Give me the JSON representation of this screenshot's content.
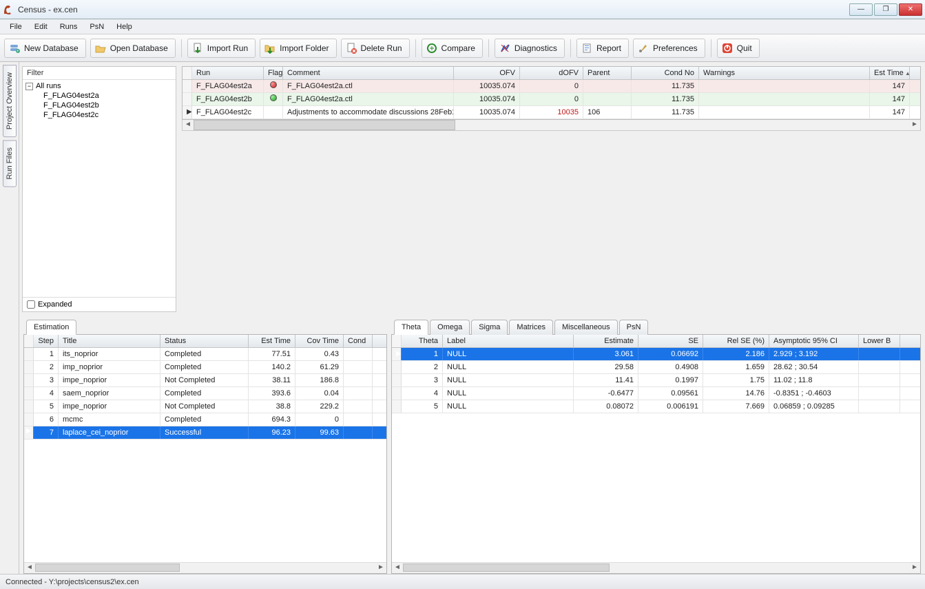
{
  "window": {
    "title": "Census - ex.cen"
  },
  "menu": [
    "File",
    "Edit",
    "Runs",
    "PsN",
    "Help"
  ],
  "toolbar": [
    {
      "k": "new-database",
      "label": "New Database"
    },
    {
      "k": "open-database",
      "label": "Open Database"
    },
    {
      "k": "import-run",
      "label": "Import Run"
    },
    {
      "k": "import-folder",
      "label": "Import Folder"
    },
    {
      "k": "delete-run",
      "label": "Delete Run"
    },
    {
      "k": "compare",
      "label": "Compare"
    },
    {
      "k": "diagnostics",
      "label": "Diagnostics"
    },
    {
      "k": "report",
      "label": "Report"
    },
    {
      "k": "preferences",
      "label": "Preferences"
    },
    {
      "k": "quit",
      "label": "Quit"
    }
  ],
  "sideTabs": {
    "project": "Project Overview",
    "runfiles": "Run Files"
  },
  "filter": {
    "label": "Filter",
    "root": "All runs",
    "children": [
      "F_FLAG04est2a",
      "F_FLAG04est2b",
      "F_FLAG04est2c"
    ],
    "expandedLabel": "Expanded"
  },
  "runs": {
    "cols": {
      "run": "Run",
      "flag": "Flag",
      "comment": "Comment",
      "ofv": "OFV",
      "dofv": "dOFV",
      "parent": "Parent",
      "cond": "Cond No",
      "warn": "Warnings",
      "et": "Est Time"
    },
    "rows": [
      {
        "flag": "red",
        "run": "F_FLAG04est2a",
        "comment": "F_FLAG04est2a.ctl",
        "ofv": "10035.074",
        "dofv": "0",
        "parent": "",
        "cond": "11.735",
        "warn": "",
        "et": "147"
      },
      {
        "flag": "green",
        "run": "F_FLAG04est2b",
        "comment": "F_FLAG04est2a.ctl",
        "ofv": "10035.074",
        "dofv": "0",
        "parent": "",
        "cond": "11.735",
        "warn": "",
        "et": "147"
      },
      {
        "flag": "",
        "run": "F_FLAG04est2c",
        "comment": "Adjustments to accommodate discussions 28Feb1",
        "ofv": "10035.074",
        "dofv": "10035",
        "parent": "106",
        "cond": "11.735",
        "warn": "",
        "et": "147",
        "current": true,
        "dofvRed": true
      }
    ]
  },
  "estimation": {
    "tab": "Estimation",
    "cols": {
      "step": "Step",
      "title": "Title",
      "status": "Status",
      "et": "Est Time",
      "ct": "Cov Time",
      "cond": "Cond"
    },
    "rows": [
      {
        "step": "1",
        "title": "its_noprior",
        "status": "Completed",
        "et": "77.51",
        "ct": "0.43"
      },
      {
        "step": "2",
        "title": "imp_noprior",
        "status": "Completed",
        "et": "140.2",
        "ct": "61.29"
      },
      {
        "step": "3",
        "title": "impe_noprior",
        "status": "Not Completed",
        "et": "38.11",
        "ct": "186.8"
      },
      {
        "step": "4",
        "title": "saem_noprior",
        "status": "Completed",
        "et": "393.6",
        "ct": "0.04"
      },
      {
        "step": "5",
        "title": "impe_noprior",
        "status": "Not Completed",
        "et": "38.8",
        "ct": "229.2"
      },
      {
        "step": "6",
        "title": "mcmc",
        "status": "Completed",
        "et": "694.3",
        "ct": "0"
      },
      {
        "step": "7",
        "title": "laplace_cei_noprior",
        "status": "Successful",
        "et": "96.23",
        "ct": "99.63",
        "selected": true
      }
    ]
  },
  "theta": {
    "tabs": [
      "Theta",
      "Omega",
      "Sigma",
      "Matrices",
      "Miscellaneous",
      "PsN"
    ],
    "cols": {
      "idx": "Theta",
      "label": "Label",
      "est": "Estimate",
      "se": "SE",
      "rel": "Rel SE (%)",
      "ci": "Asymptotic 95% CI",
      "lb": "Lower B"
    },
    "rows": [
      {
        "idx": "1",
        "label": "NULL",
        "est": "3.061",
        "se": "0.06692",
        "rel": "2.186",
        "ci": "2.929 ; 3.192",
        "selected": true
      },
      {
        "idx": "2",
        "label": "NULL",
        "est": "29.58",
        "se": "0.4908",
        "rel": "1.659",
        "ci": "28.62 ; 30.54"
      },
      {
        "idx": "3",
        "label": "NULL",
        "est": "11.41",
        "se": "0.1997",
        "rel": "1.75",
        "ci": "11.02 ; 11.8"
      },
      {
        "idx": "4",
        "label": "NULL",
        "est": "-0.6477",
        "se": "0.09561",
        "rel": "14.76",
        "ci": "-0.8351 ; -0.4603"
      },
      {
        "idx": "5",
        "label": "NULL",
        "est": "0.08072",
        "se": "0.006191",
        "rel": "7.669",
        "ci": "0.06859 ; 0.09285"
      }
    ]
  },
  "status": "Connected - Y:\\projects\\census2\\ex.cen"
}
